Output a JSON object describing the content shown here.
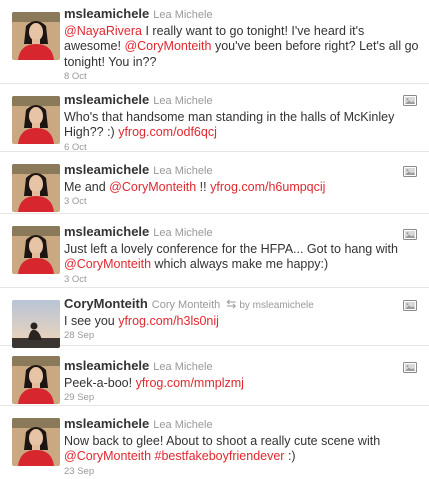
{
  "tweets": [
    {
      "screen_name": "msleamichele",
      "full_name": "Lea Michele",
      "segments": [
        {
          "t": "mention",
          "v": "@NayaRivera"
        },
        {
          "t": "text",
          "v": " I really want to go tonight! I've heard it's awesome! "
        },
        {
          "t": "mention",
          "v": "@CoryMonteith"
        },
        {
          "t": "text",
          "v": " you've been before right? Let's all go tonight! You in??"
        }
      ],
      "time": "8 Oct",
      "has_media": false,
      "retweet_by": ""
    },
    {
      "screen_name": "msleamichele",
      "full_name": "Lea Michele",
      "segments": [
        {
          "t": "text",
          "v": "Who's that handsome man standing in the halls of McKinley High?? :) "
        },
        {
          "t": "link",
          "v": "yfrog.com/odf6qcj"
        }
      ],
      "time": "6 Oct",
      "has_media": true,
      "retweet_by": ""
    },
    {
      "screen_name": "msleamichele",
      "full_name": "Lea Michele",
      "segments": [
        {
          "t": "text",
          "v": "Me and "
        },
        {
          "t": "mention",
          "v": "@CoryMonteith"
        },
        {
          "t": "text",
          "v": " !! "
        },
        {
          "t": "link",
          "v": "yfrog.com/h6umpqcij"
        }
      ],
      "time": "3 Oct",
      "has_media": true,
      "retweet_by": ""
    },
    {
      "screen_name": "msleamichele",
      "full_name": "Lea Michele",
      "segments": [
        {
          "t": "text",
          "v": "Just left a lovely conference for the HFPA... Got to hang with "
        },
        {
          "t": "mention",
          "v": "@CoryMonteith"
        },
        {
          "t": "text",
          "v": " which always make me happy:)"
        }
      ],
      "time": "3 Oct",
      "has_media": true,
      "retweet_by": ""
    },
    {
      "screen_name": "CoryMonteith",
      "full_name": "Cory Monteith",
      "segments": [
        {
          "t": "text",
          "v": "I see you "
        },
        {
          "t": "link",
          "v": "yfrog.com/h3ls0nij"
        }
      ],
      "time": "28 Sep",
      "has_media": true,
      "retweet_by": "by msleamichele"
    },
    {
      "screen_name": "msleamichele",
      "full_name": "Lea Michele",
      "segments": [
        {
          "t": "text",
          "v": "Peek-a-boo! "
        },
        {
          "t": "link",
          "v": "yfrog.com/mmplzmj"
        }
      ],
      "time": "29 Sep",
      "has_media": true,
      "retweet_by": ""
    },
    {
      "screen_name": "msleamichele",
      "full_name": "Lea Michele",
      "segments": [
        {
          "t": "text",
          "v": "Now back to glee! About to shoot a really cute scene with "
        },
        {
          "t": "mention",
          "v": "@CoryMonteith"
        },
        {
          "t": "text",
          "v": " "
        },
        {
          "t": "mention",
          "v": "#bestfakeboyfriendever"
        },
        {
          "t": "text",
          "v": " :)"
        }
      ],
      "time": "23 Sep",
      "has_media": false,
      "retweet_by": ""
    }
  ],
  "icons": {
    "retweet": "retweet-icon",
    "media": "media-icon",
    "retweet_glyph": "⇆"
  },
  "colors": {
    "link": "#e0282f",
    "muted": "#999999",
    "text": "#333333",
    "avatar_dress": "#d8262e"
  }
}
